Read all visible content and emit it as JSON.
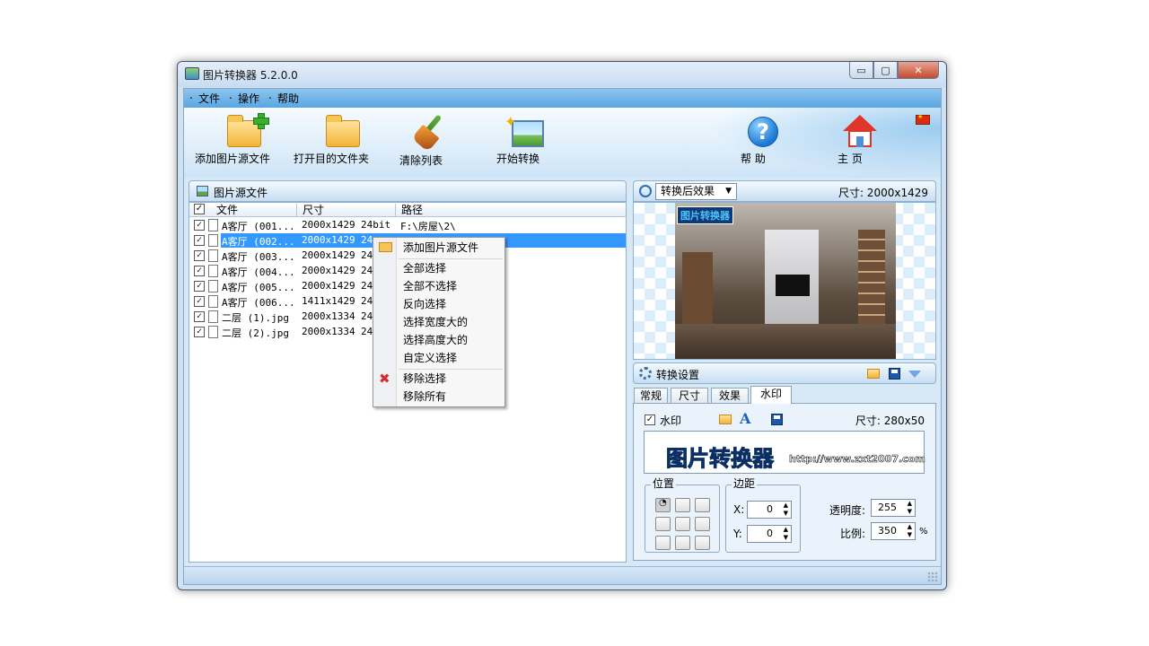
{
  "window": {
    "title": "图片转换器 5.2.0.0",
    "btn_min": "▭",
    "btn_max": "▢",
    "btn_close": "✕"
  },
  "menu": [
    "文件",
    "操作",
    "帮助"
  ],
  "toolbar": {
    "add_files": "添加图片源文件",
    "open_dest": "打开目的文件夹",
    "clear_list": "清除列表",
    "start": "开始转换",
    "help": "帮 助",
    "help_glyph": "?",
    "home": "主 页"
  },
  "source_panel": {
    "title": "图片源文件",
    "columns": {
      "file": "文件",
      "size": "尺寸",
      "path": "路径"
    },
    "header_check": "✓",
    "rows": [
      {
        "check": "✓",
        "name": "A客厅 (001...",
        "size": "2000x1429",
        "bit": "24bit",
        "path": "F:\\房屋\\2\\"
      },
      {
        "check": "✓",
        "name": "A客厅 (002...",
        "size": "2000x1429",
        "bit": "24",
        "path": ""
      },
      {
        "check": "✓",
        "name": "A客厅 (003...",
        "size": "2000x1429",
        "bit": "24",
        "path": ""
      },
      {
        "check": "✓",
        "name": "A客厅 (004...",
        "size": "2000x1429",
        "bit": "24",
        "path": ""
      },
      {
        "check": "✓",
        "name": "A客厅 (005...",
        "size": "2000x1429",
        "bit": "24",
        "path": ""
      },
      {
        "check": "✓",
        "name": "A客厅 (006...",
        "size": "1411x1429",
        "bit": "24",
        "path": ""
      },
      {
        "check": "✓",
        "name": "二层 (1).jpg",
        "size": "2000x1334",
        "bit": "24",
        "path": ""
      },
      {
        "check": "✓",
        "name": "二层 (2).jpg",
        "size": "2000x1334",
        "bit": "24",
        "path": ""
      }
    ]
  },
  "context_menu": {
    "add": "添加图片源文件",
    "select_all": "全部选择",
    "select_none": "全部不选择",
    "invert": "反向选择",
    "select_wide": "选择宽度大的",
    "select_tall": "选择高度大的",
    "custom": "自定义选择",
    "remove_sel": "移除选择",
    "remove_all": "移除所有",
    "remove_glyph": "✖"
  },
  "preview": {
    "mode": "转换后效果",
    "size_label": "尺寸: 2000x1429",
    "watermark_small": "图片转换器"
  },
  "settings": {
    "title": "转换设置",
    "tabs": [
      "常规",
      "尺寸",
      "效果",
      "水印"
    ],
    "active_tab": "水印",
    "watermark": {
      "check": "✓",
      "label": "水印",
      "size": "尺寸: 280x50",
      "a_glyph": "A",
      "text": "图片转换器",
      "url": "http://www.zxt2007.com"
    },
    "position_group": "位置",
    "margin_group": "边距",
    "x_label": "X:",
    "x_value": "0",
    "y_label": "Y:",
    "y_value": "0",
    "opacity_label": "透明度:",
    "opacity_value": "255",
    "scale_label": "比例:",
    "scale_value": "350",
    "scale_unit": "%"
  }
}
